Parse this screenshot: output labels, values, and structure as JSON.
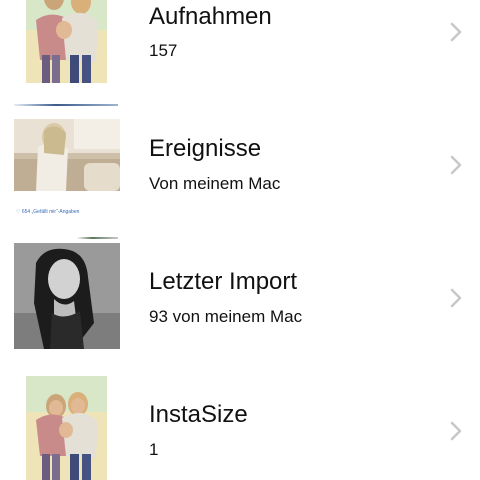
{
  "albums": [
    {
      "title": "Aufnahmen",
      "subtitle": "157",
      "thumb_icon": "girls-selfie-photo",
      "chevron_icon": "chevron-right-icon"
    },
    {
      "title": "Ereignisse",
      "subtitle": "Von meinem Mac",
      "thumb_icon": "girl-on-sofa-photo",
      "chevron_icon": "chevron-right-icon"
    },
    {
      "title": "Letzter Import",
      "subtitle": "93 von meinem Mac",
      "thumb_icon": "bw-portrait-photo",
      "chevron_icon": "chevron-right-icon"
    },
    {
      "title": "InstaSize",
      "subtitle": "1",
      "thumb_icon": "girls-selfie-photo",
      "chevron_icon": "chevron-right-icon"
    }
  ],
  "likes_caption": "♡ 654 „Gefällt mir“-Angaben",
  "colors": {
    "chevron": "#c7c7cc",
    "text": "#111111",
    "caption": "#3a6db5"
  }
}
